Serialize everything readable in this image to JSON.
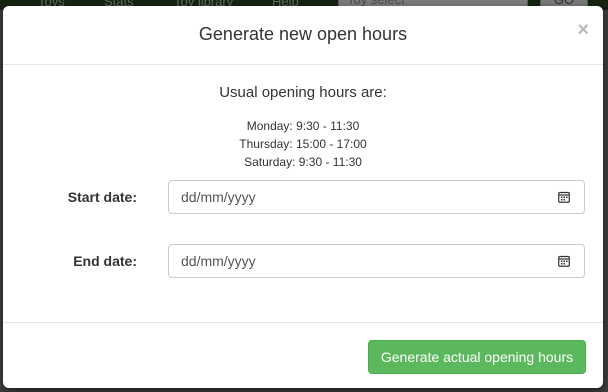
{
  "background": {
    "nav": [
      "Toys",
      "Stats",
      "Toy library",
      "Help"
    ],
    "search_placeholder": "Toy select",
    "search_button": "GO"
  },
  "modal": {
    "title": "Generate new open hours",
    "close_label": "×",
    "intro": "Usual opening hours are:",
    "hours": [
      "Monday: 9:30 - 11:30",
      "Thursday: 15:00 - 17:00",
      "Saturday: 9:30 - 11:30"
    ],
    "start_date": {
      "label": "Start date:",
      "placeholder": "dd/mm/yyyy"
    },
    "end_date": {
      "label": "End date:",
      "placeholder": "dd/mm/yyyy"
    },
    "submit_label": "Generate actual opening hours"
  },
  "colors": {
    "primary": "#5cb85c",
    "nav": "#2a4a22"
  }
}
